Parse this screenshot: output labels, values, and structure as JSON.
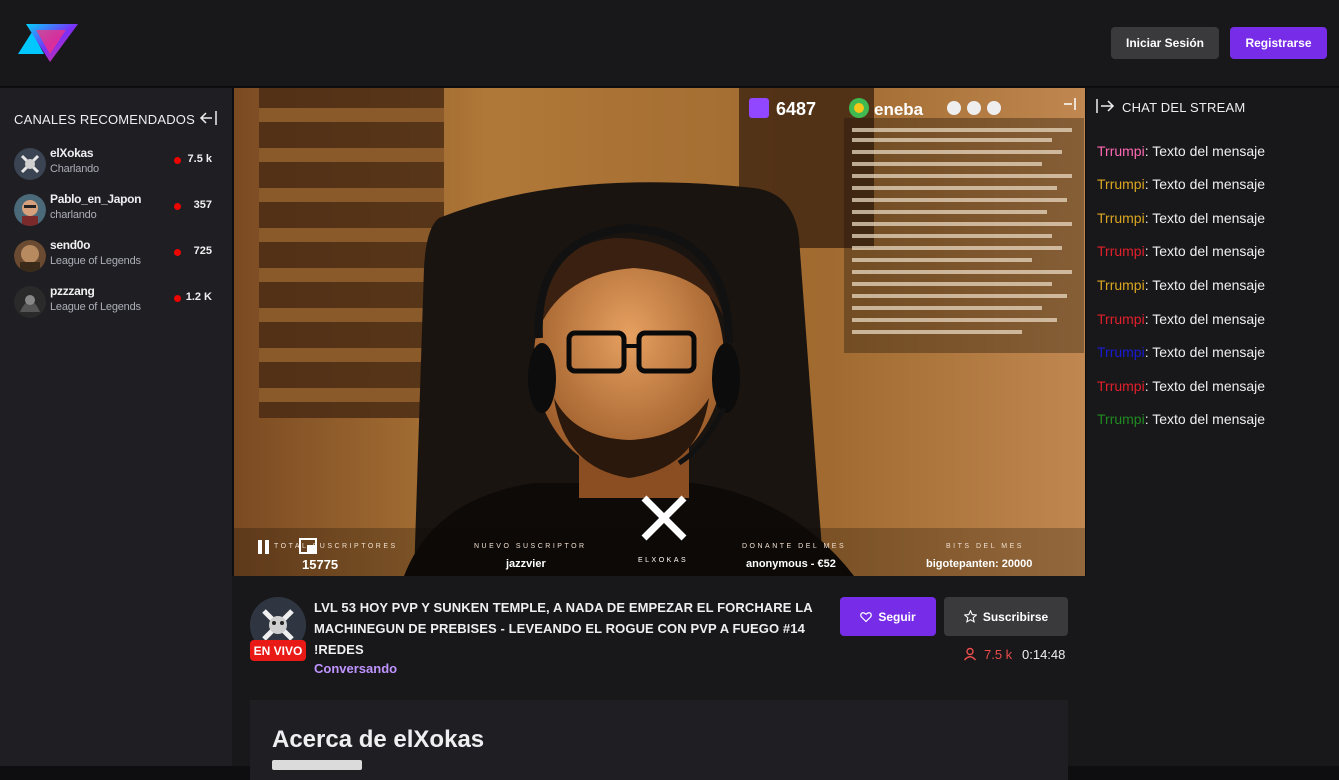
{
  "header": {
    "login_label": "Iniciar Sesión",
    "register_label": "Registrarse"
  },
  "sidebar": {
    "title": "CANALES RECOMENDADOS",
    "channels": [
      {
        "name": "elXokas",
        "game": "Charlando",
        "viewers": "7.5 k"
      },
      {
        "name": "Pablo_en_Japon",
        "game": "charlando",
        "viewers": "357"
      },
      {
        "name": "send0o",
        "game": "League of Legends",
        "viewers": "725"
      },
      {
        "name": "pzzzang",
        "game": "League of Legends",
        "viewers": "1.2 K"
      }
    ]
  },
  "video": {
    "follower_count": "6487",
    "sponsor": "eneba",
    "overlay_labels": {
      "total_subs_label": "TOTAL SUSCRIPTORES",
      "total_subs": "15775",
      "new_sub_label": "NUEVO SUSCRIPTOR",
      "new_sub": "jazzvier",
      "donor_label": "DONANTE DEL MES",
      "donor": "anonymous - €52",
      "bits_label": "BITS DEL MES",
      "bits": "bigotepanten: 20000",
      "brand": "ELXOKAS"
    }
  },
  "stream": {
    "title": "LVL 53 HOY PVP Y SUNKEN TEMPLE, A NADA DE EMPEZAR EL FORCHARE LA MACHINEGUN DE PREBISES - LEVEANDO EL ROGUE CON PVP A FUEGO #14 !REDES",
    "category": "Conversando",
    "live_label": "EN VIVO",
    "follow_label": "Seguir",
    "subscribe_label": "Suscribirse",
    "viewers": "7.5 k",
    "uptime": "0:14:48"
  },
  "about": {
    "title": "Acerca de elXokas"
  },
  "chat": {
    "title": "CHAT DEL STREAM",
    "messages": [
      {
        "user": "Trrumpi",
        "text": ": Texto del mensaje",
        "color": "#ff69b4"
      },
      {
        "user": "Trrumpi",
        "text": ": Texto del mensaje",
        "color": "#daa520"
      },
      {
        "user": "Trrumpi",
        "text": ": Texto del mensaje",
        "color": "#daa520"
      },
      {
        "user": "Trrumpi",
        "text": ": Texto del mensaje",
        "color": "#e0202a"
      },
      {
        "user": "Trrumpi",
        "text": ": Texto del mensaje",
        "color": "#daa520"
      },
      {
        "user": "Trrumpi",
        "text": ": Texto del mensaje",
        "color": "#e0202a"
      },
      {
        "user": "Trrumpi",
        "text": ": Texto del mensaje",
        "color": "#1a1ad6"
      },
      {
        "user": "Trrumpi",
        "text": ": Texto del mensaje",
        "color": "#e0202a"
      },
      {
        "user": "Trrumpi",
        "text": ": Texto del mensaje",
        "color": "#1f8a1f"
      }
    ]
  },
  "colors": {
    "accent": "#772ce8",
    "live": "#e91916",
    "category": "#bf94ff"
  }
}
